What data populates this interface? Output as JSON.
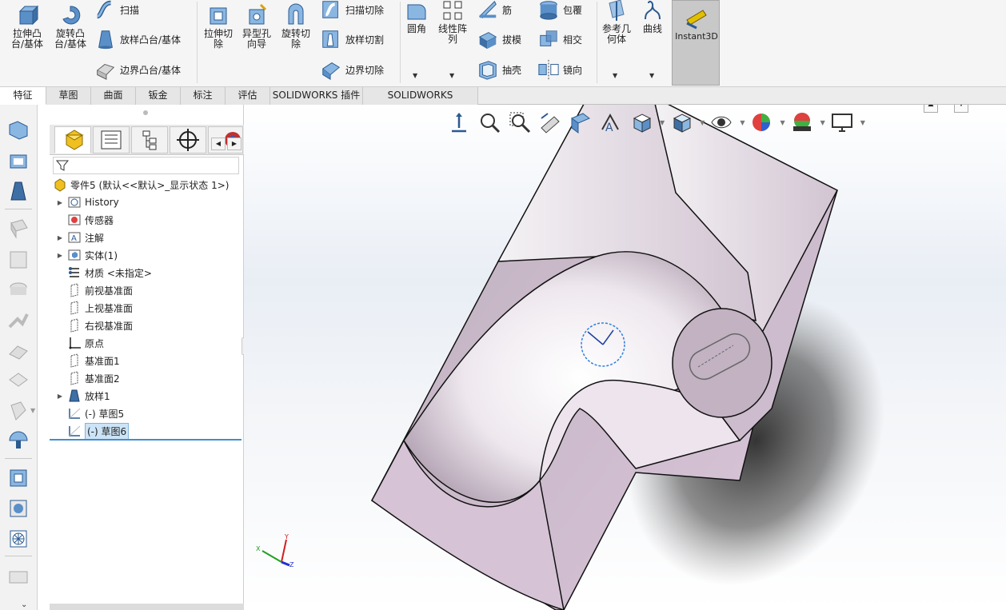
{
  "ribbon": {
    "extrude_boss": "拉伸凸\n台/基体",
    "revolve_boss": "旋转凸\n台/基体",
    "sweep": "扫描",
    "loft_boss": "放样凸台/基体",
    "boundary_boss": "边界凸台/基体",
    "extrude_cut": "拉伸切\n除",
    "hole_wizard": "异型孔\n向导",
    "revolve_cut": "旋转切\n除",
    "sweep_cut": "扫描切除",
    "loft_cut": "放样切割",
    "boundary_cut": "边界切除",
    "fillet": "圆角",
    "linear_pattern": "线性阵\n列",
    "rib": "筋",
    "draft": "拔模",
    "shell": "抽壳",
    "wrap": "包覆",
    "intersect": "相交",
    "mirror": "镜向",
    "reference_geometry": "参考几\n何体",
    "curves": "曲线",
    "instant3d": "Instant3D"
  },
  "tabs": [
    {
      "label": "特征",
      "active": true
    },
    {
      "label": "草图",
      "active": false
    },
    {
      "label": "曲面",
      "active": false
    },
    {
      "label": "钣金",
      "active": false
    },
    {
      "label": "标注",
      "active": false
    },
    {
      "label": "评估",
      "active": false
    },
    {
      "label": "SOLIDWORKS 插件",
      "active": false
    },
    {
      "label": "SOLIDWORKS Inspection",
      "active": false
    }
  ],
  "tree": {
    "root": "零件5 (默认<<默认>_显示状态 1>)",
    "items": [
      {
        "label": "History",
        "icon": "history-icon",
        "expandable": true
      },
      {
        "label": "传感器",
        "icon": "sensor-icon",
        "expandable": false
      },
      {
        "label": "注解",
        "icon": "annotation-icon",
        "expandable": true
      },
      {
        "label": "实体(1)",
        "icon": "solid-body-icon",
        "expandable": true
      },
      {
        "label": "材质 <未指定>",
        "icon": "material-icon",
        "expandable": false
      },
      {
        "label": "前视基准面",
        "icon": "plane-icon",
        "expandable": false
      },
      {
        "label": "上视基准面",
        "icon": "plane-icon",
        "expandable": false
      },
      {
        "label": "右视基准面",
        "icon": "plane-icon",
        "expandable": false
      },
      {
        "label": "原点",
        "icon": "origin-icon",
        "expandable": false
      },
      {
        "label": "基准面1",
        "icon": "plane-icon",
        "expandable": false
      },
      {
        "label": "基准面2",
        "icon": "plane-icon",
        "expandable": false
      },
      {
        "label": "放样1",
        "icon": "loft-icon",
        "expandable": true
      },
      {
        "label": "(-) 草图5",
        "icon": "sketch-icon",
        "expandable": false
      },
      {
        "label": "(-) 草图6",
        "icon": "sketch-icon",
        "expandable": false,
        "selected": true
      }
    ]
  },
  "triad": {
    "x": "X",
    "y": "Y",
    "z": "Z"
  },
  "colors": {
    "ribbon_bg": "#f5f5f5",
    "selection": "#cce4f7",
    "accent": "#3f8fd2",
    "model_face": "#d8cbd8",
    "instant3d_bg": "#c8c8c8"
  }
}
